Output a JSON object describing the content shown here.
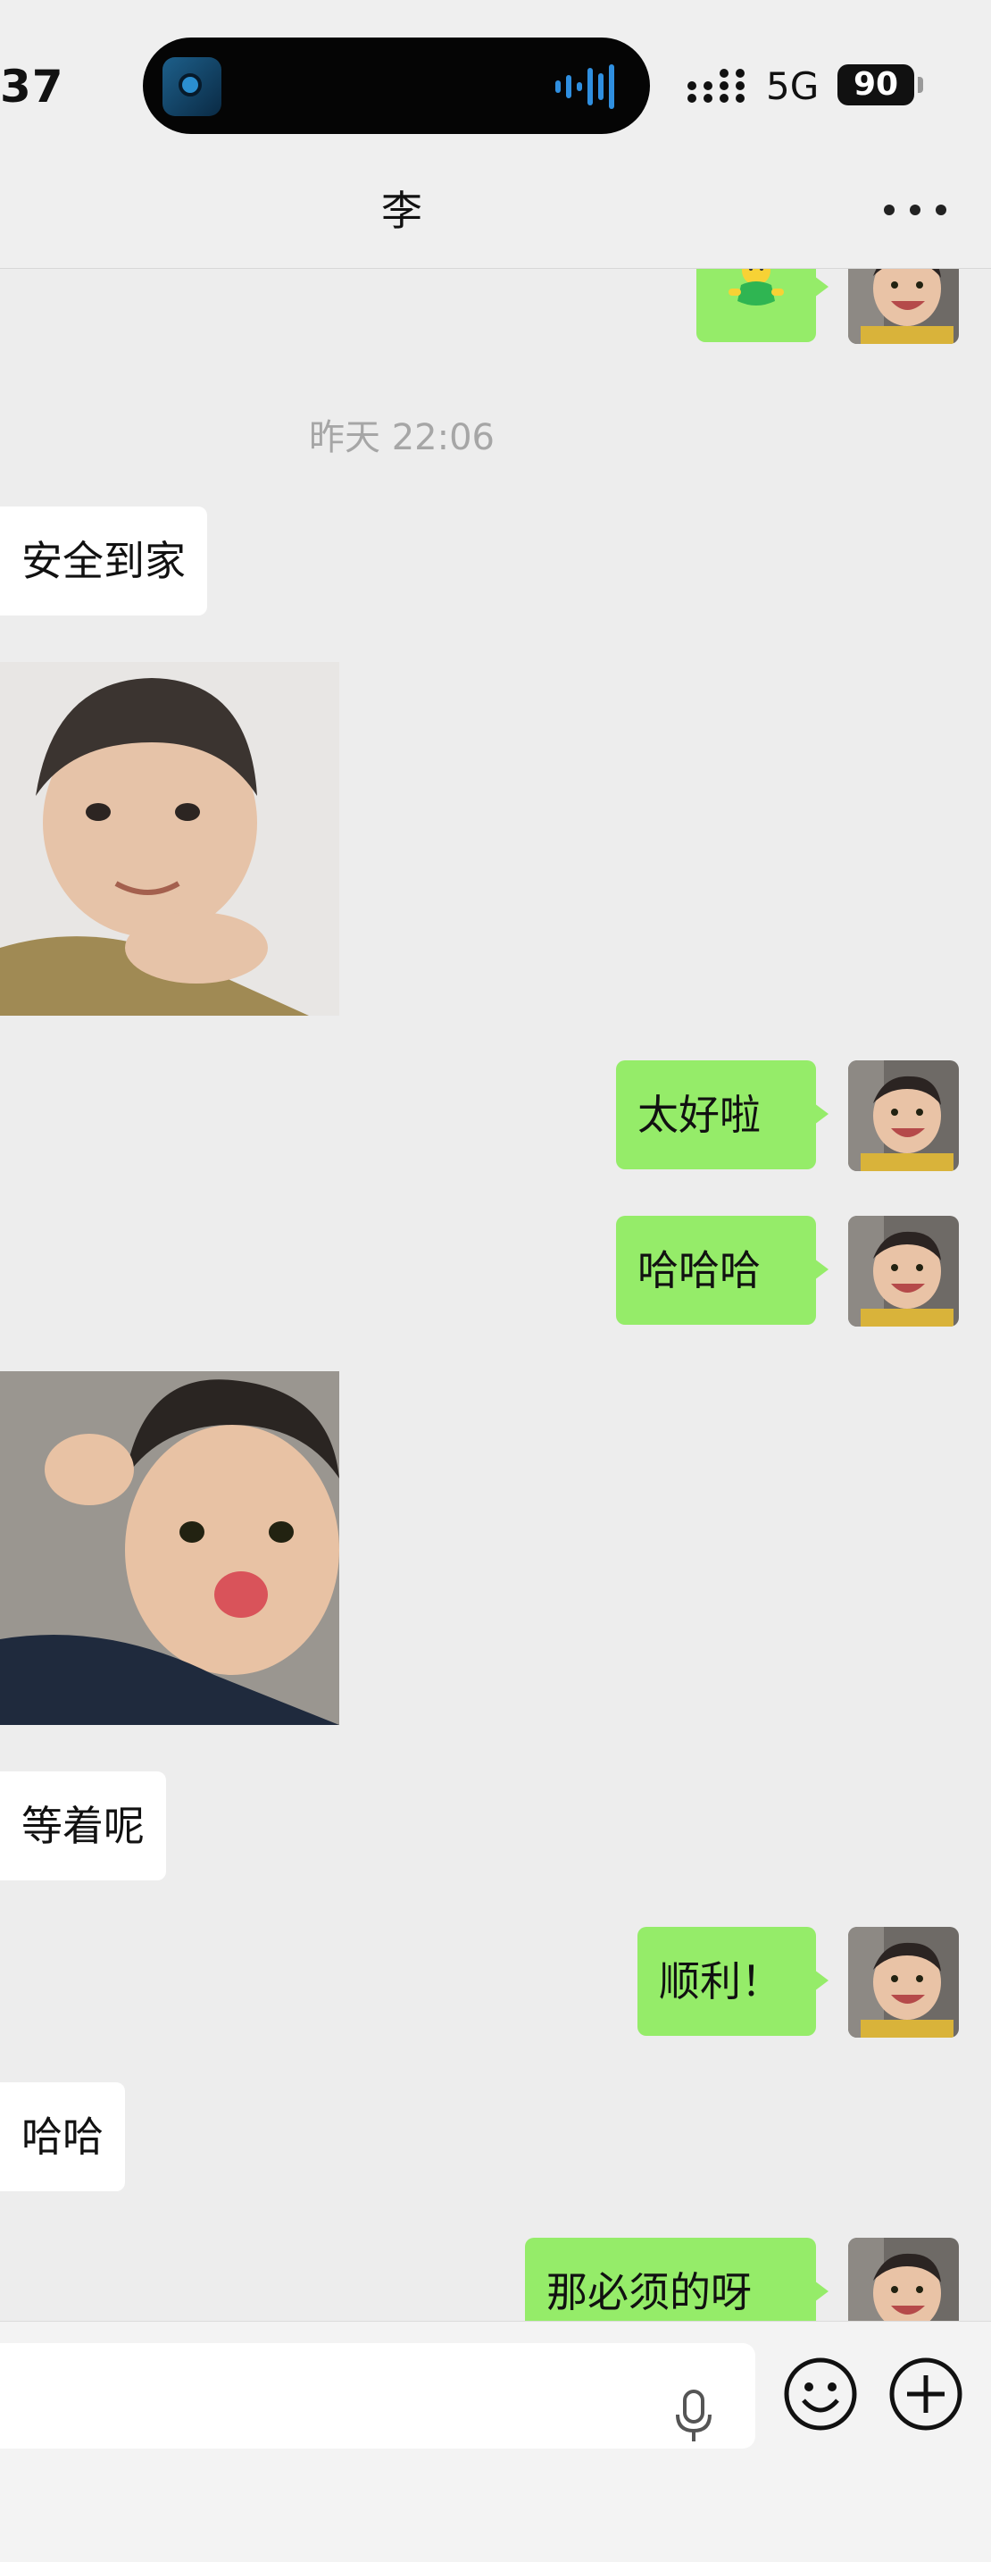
{
  "status_bar": {
    "time": "37",
    "network": "5G",
    "battery": "90",
    "icons": [
      "music-app-icon",
      "audio-wave-icon",
      "signal-icon",
      "battery-icon"
    ]
  },
  "nav": {
    "title": "李",
    "more_icon": "more-dots-icon"
  },
  "messages": {
    "timestamp": "昨天 22:06",
    "top_sticker_icon": "green-figure-sticker",
    "m1": "安全到家",
    "m2": "太好啦",
    "m3": "哈哈哈",
    "m4": "等着呢",
    "m5": "顺利！",
    "m6": "哈哈",
    "m7": "那必须的呀"
  },
  "input_bar": {
    "placeholder": "",
    "icons": [
      "mic-icon",
      "emoji-icon",
      "plus-icon"
    ]
  },
  "colors": {
    "background": "#ededed",
    "sent_bubble": "#95ec69",
    "received_bubble": "#ffffff"
  }
}
